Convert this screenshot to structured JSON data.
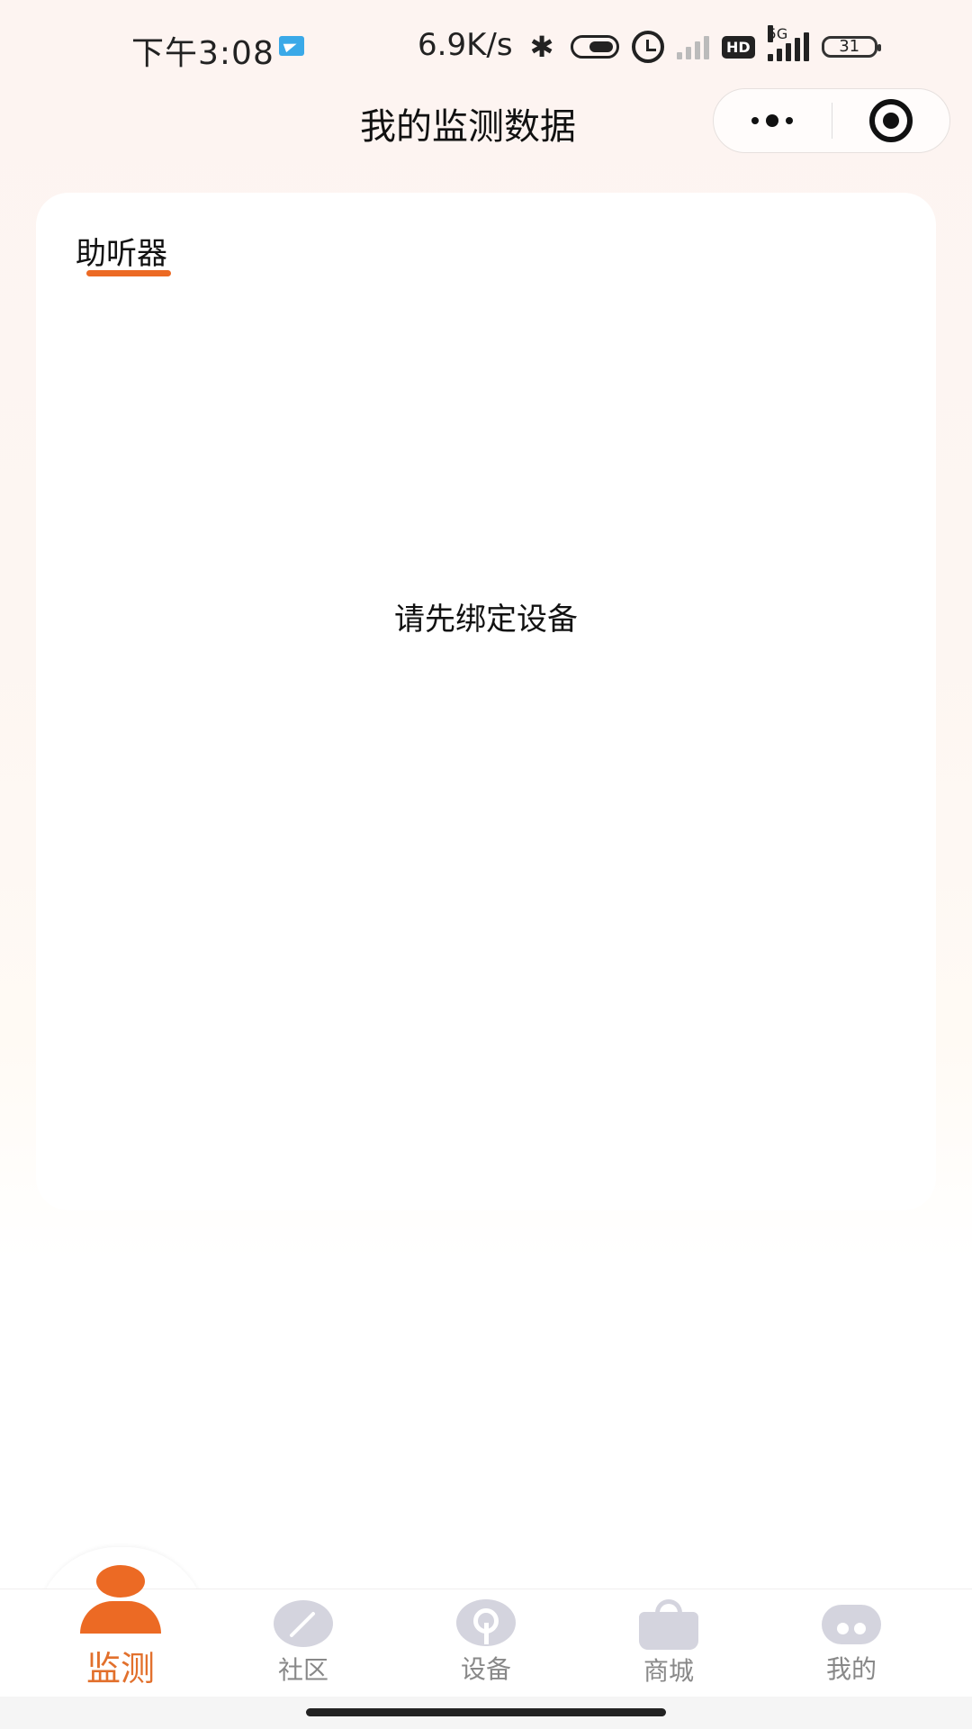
{
  "status_bar": {
    "time": "下午3:08",
    "net_speed": "6.9K/s",
    "hd_label": "HD",
    "network_label": "5G",
    "battery": "31",
    "icons": [
      "telegram-icon",
      "bluetooth-icon",
      "vibrate-icon",
      "alarm-icon",
      "signal-weak-icon",
      "hd-icon",
      "signal-5g-icon",
      "battery-icon"
    ]
  },
  "nav": {
    "title": "我的监测数据",
    "more_icon": "more-dots-icon",
    "close_icon": "target-close-icon"
  },
  "card": {
    "tabs": [
      {
        "label": "助听器",
        "active": true
      }
    ],
    "empty_message": "请先绑定设备"
  },
  "tabbar": {
    "accent_color": "#ec6a24",
    "inactive_color": "#888888",
    "items": [
      {
        "label": "监测",
        "icon": "person-icon",
        "active": true
      },
      {
        "label": "社区",
        "icon": "community-icon",
        "active": false
      },
      {
        "label": "设备",
        "icon": "device-icon",
        "active": false
      },
      {
        "label": "商城",
        "icon": "shopping-bag-icon",
        "active": false
      },
      {
        "label": "我的",
        "icon": "profile-icon",
        "active": false
      }
    ]
  }
}
